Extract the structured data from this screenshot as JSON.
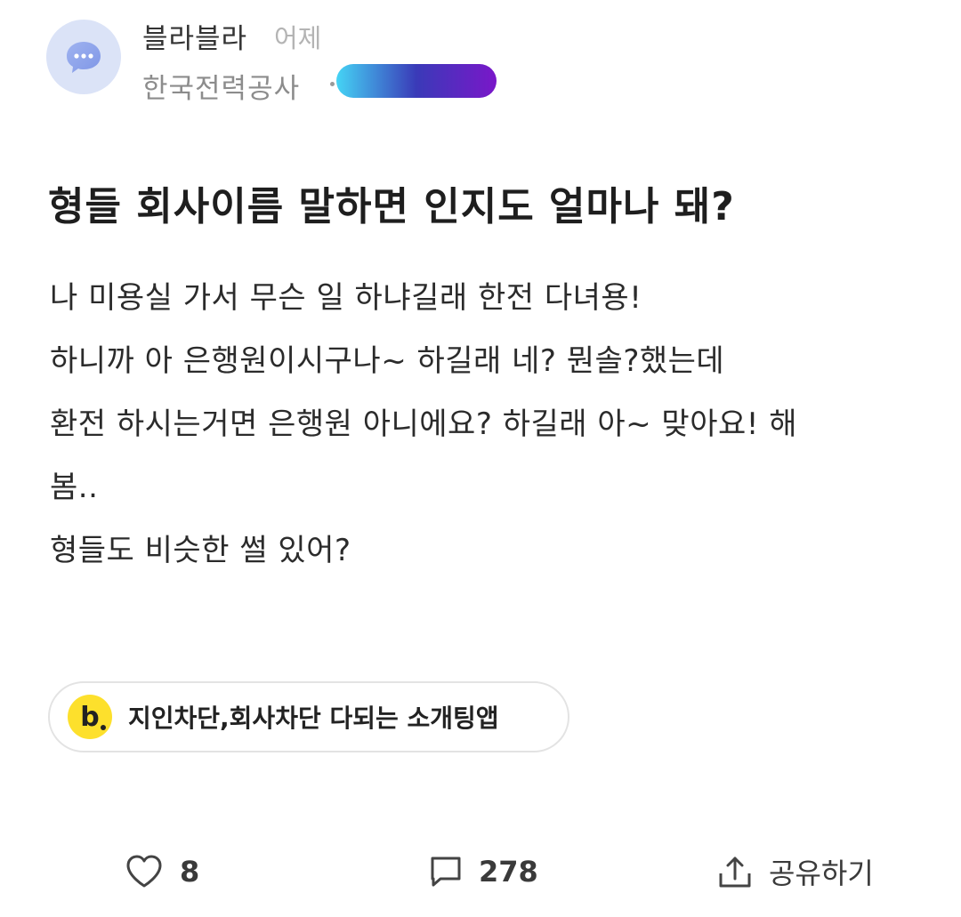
{
  "header": {
    "board_name": "블라블라",
    "post_time": "어제",
    "company": "한국전력공사",
    "avatar_icon": "chat-bubble-icon",
    "avatar_color": "#dbe3f7",
    "nickname_gradient": [
      "#45d4f5",
      "#3a3ab8",
      "#7a17c9"
    ]
  },
  "post": {
    "title": "형들 회사이름 말하면 인지도 얼마나 돼?",
    "body_lines": [
      "나 미용실 가서 무슨 일 하냐길래 한전 다녀용!",
      "하니까 아 은행원이시구나~ 하길래 네? 뭔솔?했는데",
      "환전 하시는거면 은행원 아니에요? 하길래 아~ 맞아요! 해",
      "봄..",
      "형들도 비슷한 썰 있어?"
    ]
  },
  "ad": {
    "logo_letter": "b",
    "logo_color": "#fde02c",
    "text": "지인차단,회사차단 다되는 소개팅앱"
  },
  "actions": {
    "like_icon": "heart-icon",
    "like_count": "8",
    "comment_icon": "comment-icon",
    "comment_count": "278",
    "share_icon": "share-icon",
    "share_label": "공유하기"
  }
}
